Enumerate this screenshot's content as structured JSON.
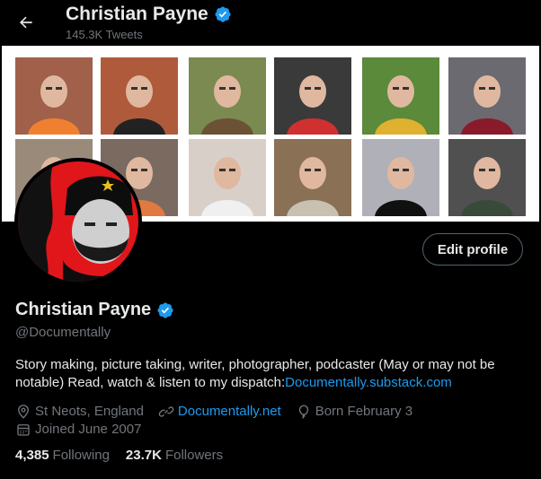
{
  "header": {
    "name": "Christian Payne",
    "tweet_count": "145.3K Tweets"
  },
  "profile": {
    "name": "Christian Payne",
    "handle": "@Documentally",
    "bio_text": "Story making, picture taking, writer, photographer, podcaster (May or may not be notable) Read, watch & listen to my dispatch:",
    "bio_link": "Documentally.substack.com",
    "location": "St Neots, England",
    "website": "Documentally.net",
    "born": "Born February 3",
    "joined": "Joined June 2007",
    "edit_label": "Edit profile"
  },
  "stats": {
    "following_count": "4,385",
    "following_label": "Following",
    "followers_count": "23.7K",
    "followers_label": "Followers"
  },
  "banner": {
    "thumbnails": [
      {
        "name": "thumb-1",
        "bg": "#a0604a",
        "accent": "#f08030"
      },
      {
        "name": "thumb-2",
        "bg": "#b05a3c",
        "accent": "#222222"
      },
      {
        "name": "thumb-3",
        "bg": "#7a8a50",
        "accent": "#6b5235"
      },
      {
        "name": "thumb-4",
        "bg": "#3a3a3a",
        "accent": "#d03030"
      },
      {
        "name": "thumb-5",
        "bg": "#5a8a3a",
        "accent": "#e0b030"
      },
      {
        "name": "thumb-6",
        "bg": "#6a6a70",
        "accent": "#8a1a2a"
      },
      {
        "name": "thumb-7",
        "bg": "#9a8a7a",
        "accent": "#2a2a2a"
      },
      {
        "name": "thumb-8",
        "bg": "#7a6a60",
        "accent": "#e07a40"
      },
      {
        "name": "thumb-9",
        "bg": "#d8d0c8",
        "accent": "#f0f0f0"
      },
      {
        "name": "thumb-10",
        "bg": "#8a7055",
        "accent": "#c8c0b0"
      },
      {
        "name": "thumb-11",
        "bg": "#b0b0b8",
        "accent": "#101010"
      },
      {
        "name": "thumb-12",
        "bg": "#505050",
        "accent": "#3a4a3a"
      }
    ]
  },
  "colors": {
    "accent": "#1d9bf0",
    "muted": "#71767b",
    "avatar_red": "#e0161b"
  }
}
